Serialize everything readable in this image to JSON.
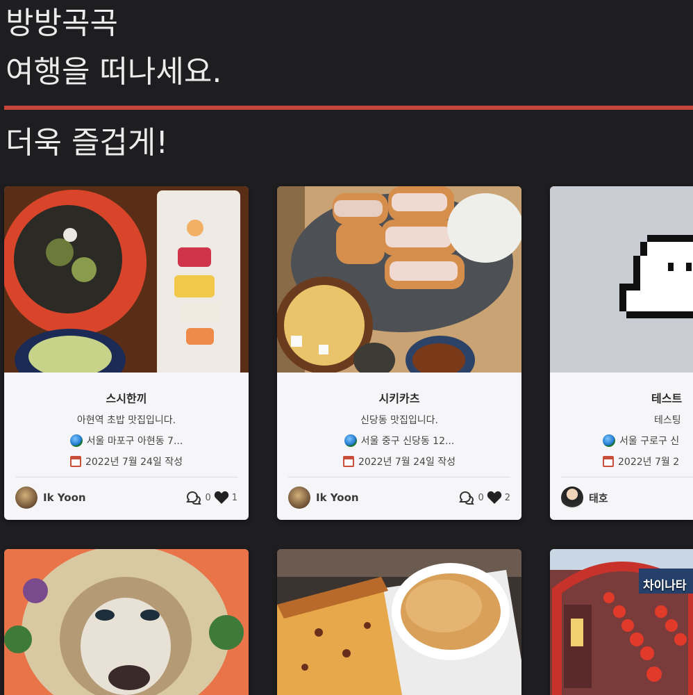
{
  "hero": {
    "line1": "방방곡곡",
    "line2": "여행을 떠나세요.",
    "line3": "더욱 즐겁게!"
  },
  "colors": {
    "background": "#1e1d1f",
    "accent_divider": "#c8453c",
    "card_bg": "#f6f6f8"
  },
  "posts": [
    {
      "title": "스시한끼",
      "description": "아현역 초밥 맛집입니다.",
      "address": "서울 마포구 아현동 7...",
      "date": "2022년 7월 24일 작성",
      "author": "Ik Yoon",
      "comments": "0",
      "likes": "1",
      "image": "food-sushi-photo"
    },
    {
      "title": "시키카츠",
      "description": "신당동 맛집입니다.",
      "address": "서울 중구 신당동 12...",
      "date": "2022년 7월 24일 작성",
      "author": "Ik Yoon",
      "comments": "0",
      "likes": "2",
      "image": "food-tonkatsu-photo"
    },
    {
      "title": "테스트",
      "description": "테스팅",
      "address": "서울 구로구 신",
      "date": "2022년 7월 2",
      "author": "태호",
      "image": "ghost-pixel-art"
    },
    {
      "image": "lion-noodle-art-photo"
    },
    {
      "image": "cake-and-coffee-photo"
    },
    {
      "image": "chinatown-street-photo",
      "sign_text": "차이나타"
    }
  ]
}
